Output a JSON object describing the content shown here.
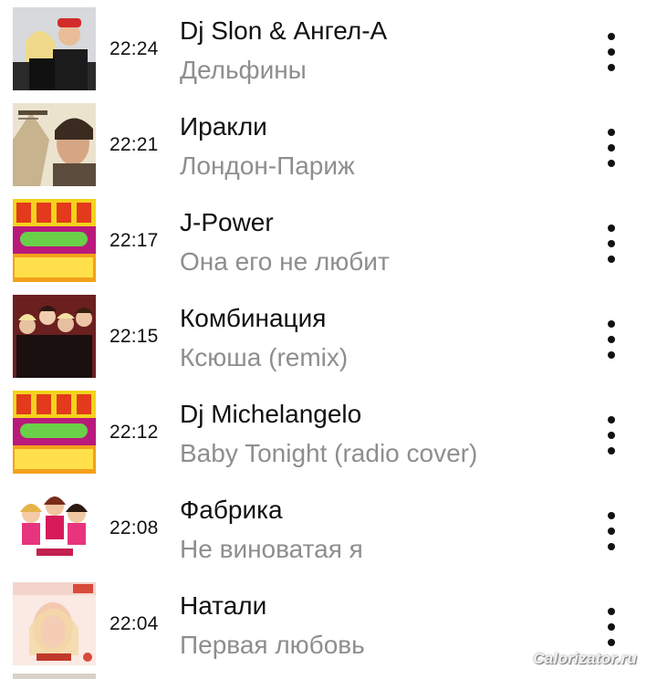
{
  "tracks": [
    {
      "time": "22:24",
      "artist": "Dj Slon & Ангел-А",
      "song": "Дельфины"
    },
    {
      "time": "22:21",
      "artist": "Иракли",
      "song": "Лондон-Париж"
    },
    {
      "time": "22:17",
      "artist": "J-Power",
      "song": "Она его не любит"
    },
    {
      "time": "22:15",
      "artist": "Комбинация",
      "song": "Ксюша (remix)"
    },
    {
      "time": "22:12",
      "artist": "Dj Michelangelo",
      "song": "Baby Tonight (radio cover)"
    },
    {
      "time": "22:08",
      "artist": "Фабрика",
      "song": "Не виноватая я"
    },
    {
      "time": "22:04",
      "artist": "Натали",
      "song": "Первая любовь"
    }
  ],
  "watermark": "Calorizator.ru",
  "icons": {
    "more": "more-vertical-icon"
  },
  "colors": {
    "artist_text": "#111111",
    "song_text": "#8e8e8e",
    "background": "#ffffff"
  }
}
